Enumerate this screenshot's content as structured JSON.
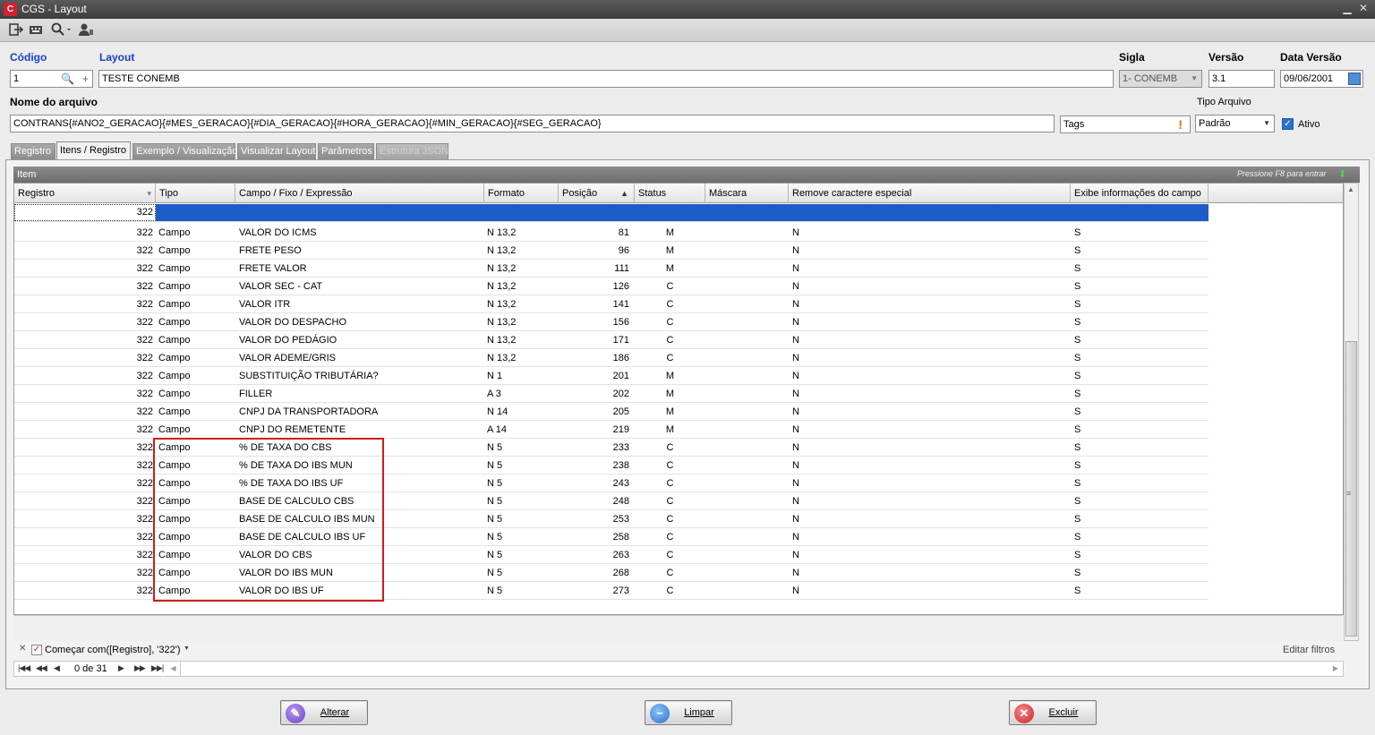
{
  "window": {
    "app_letter": "C",
    "title": "CGS - Layout",
    "minimize": "▁",
    "close": "✕"
  },
  "form": {
    "codigo_label": "Código",
    "codigo_value": "1",
    "layout_label": "Layout",
    "layout_value": "TESTE CONEMB",
    "sigla_label": "Sigla",
    "sigla_value": "1- CONEMB",
    "versao_label": "Versão",
    "versao_value": "3.1",
    "data_versao_label": "Data Versão",
    "data_versao_value": "09/06/2001",
    "nome_arquivo_label": "Nome do arquivo",
    "nome_arquivo_value": "CONTRANS{#ANO2_GERACAO}{#MES_GERACAO}{#DIA_GERACAO}{#HORA_GERACAO}{#MIN_GERACAO}{#SEG_GERACAO}",
    "tags_value": "Tags",
    "tags_warn": "!",
    "tipo_arquivo_label": "Tipo Arquivo",
    "tipo_arquivo_value": "Padrão",
    "ativo_label": "Ativo"
  },
  "tabs": [
    "Registro",
    "Itens / Registro",
    "Exemplo / Visualização",
    "Visualizar Layout",
    "Parâmetros",
    "Estrutura JSON"
  ],
  "group": {
    "title": "Item",
    "hint": "Pressione F8 para entrar"
  },
  "columns": [
    "Registro",
    "Tipo",
    "Campo / Fixo / Expressão",
    "Formato",
    "Posição",
    "Status",
    "Máscara",
    "Remove caractere especial",
    "Exibe informações do campo"
  ],
  "new_row_registro": "322",
  "rows": [
    [
      "322",
      "Campo",
      "VALOR DO ICMS",
      "N 13,2",
      "81",
      "M",
      "",
      "N",
      "S"
    ],
    [
      "322",
      "Campo",
      "FRETE PESO",
      "N 13,2",
      "96",
      "M",
      "",
      "N",
      "S"
    ],
    [
      "322",
      "Campo",
      "FRETE VALOR",
      "N 13,2",
      "111",
      "M",
      "",
      "N",
      "S"
    ],
    [
      "322",
      "Campo",
      "VALOR SEC - CAT",
      "N 13,2",
      "126",
      "C",
      "",
      "N",
      "S"
    ],
    [
      "322",
      "Campo",
      "VALOR ITR",
      "N 13,2",
      "141",
      "C",
      "",
      "N",
      "S"
    ],
    [
      "322",
      "Campo",
      "VALOR DO DESPACHO",
      "N 13,2",
      "156",
      "C",
      "",
      "N",
      "S"
    ],
    [
      "322",
      "Campo",
      "VALOR DO PEDÁGIO",
      "N 13,2",
      "171",
      "C",
      "",
      "N",
      "S"
    ],
    [
      "322",
      "Campo",
      "VALOR ADEME/GRIS",
      "N 13,2",
      "186",
      "C",
      "",
      "N",
      "S"
    ],
    [
      "322",
      "Campo",
      "SUBSTITUIÇÃO TRIBUTÁRIA?",
      "N 1",
      "201",
      "M",
      "",
      "N",
      "S"
    ],
    [
      "322",
      "Campo",
      "FILLER",
      "A 3",
      "202",
      "M",
      "",
      "N",
      "S"
    ],
    [
      "322",
      "Campo",
      "CNPJ DA TRANSPORTADORA",
      "N 14",
      "205",
      "M",
      "",
      "N",
      "S"
    ],
    [
      "322",
      "Campo",
      "CNPJ DO REMETENTE",
      "A 14",
      "219",
      "M",
      "",
      "N",
      "S"
    ],
    [
      "322",
      "Campo",
      "% DE TAXA DO CBS",
      "N 5",
      "233",
      "C",
      "",
      "N",
      "S"
    ],
    [
      "322",
      "Campo",
      "% DE TAXA DO IBS MUN",
      "N 5",
      "238",
      "C",
      "",
      "N",
      "S"
    ],
    [
      "322",
      "Campo",
      "% DE TAXA DO IBS UF",
      "N 5",
      "243",
      "C",
      "",
      "N",
      "S"
    ],
    [
      "322",
      "Campo",
      "BASE DE CALCULO CBS",
      "N 5",
      "248",
      "C",
      "",
      "N",
      "S"
    ],
    [
      "322",
      "Campo",
      "BASE DE CALCULO IBS MUN",
      "N 5",
      "253",
      "C",
      "",
      "N",
      "S"
    ],
    [
      "322",
      "Campo",
      "BASE DE CALCULO IBS UF",
      "N 5",
      "258",
      "C",
      "",
      "N",
      "S"
    ],
    [
      "322",
      "Campo",
      "VALOR DO CBS",
      "N 5",
      "263",
      "C",
      "",
      "N",
      "S"
    ],
    [
      "322",
      "Campo",
      "VALOR DO IBS MUN",
      "N 5",
      "268",
      "C",
      "",
      "N",
      "S"
    ],
    [
      "322",
      "Campo",
      "VALOR DO IBS UF",
      "N 5",
      "273",
      "C",
      "",
      "N",
      "S"
    ]
  ],
  "filter": {
    "text": "Começar com([Registro], '322')",
    "edit_label": "Editar filtros"
  },
  "nav": {
    "record_text": "0 de 31"
  },
  "buttons": {
    "alterar": "Alterar",
    "limpar": "Limpar",
    "excluir": "Excluir"
  },
  "colors": {
    "selection": "#1e5cc8",
    "highlight_box": "#d01c1c",
    "label_blue": "#1a3fc7"
  }
}
